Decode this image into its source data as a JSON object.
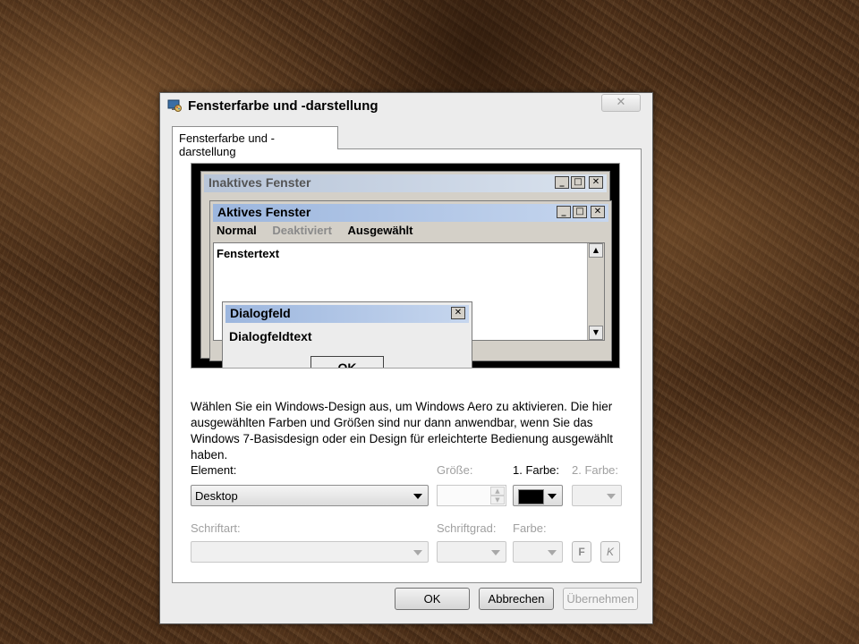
{
  "dialog": {
    "title": "Fensterfarbe und -darstellung",
    "close_glyph": "✕",
    "tab_label": "Fensterfarbe und -darstellung",
    "icon": "monitor-palette-icon"
  },
  "preview": {
    "inactive_title": "Inaktives Fenster",
    "active_title": "Aktives Fenster",
    "menu": [
      "Normal",
      "Deaktiviert",
      "Ausgewählt"
    ],
    "window_text": "Fenstertext",
    "dialog_title": "Dialogfeld",
    "dialog_text": "Dialogfeldtext",
    "ok_label": "OK"
  },
  "description": "Wählen Sie ein Windows-Design aus, um Windows Aero zu aktivieren. Die hier ausgewählten Farben und Größen sind nur dann anwendbar, wenn Sie das Windows 7-Basisdesign oder ein Design für erleichterte Bedienung ausgewählt haben.",
  "element": {
    "label": "Element:",
    "value": "Desktop"
  },
  "groesse": {
    "label": "Größe:",
    "value": ""
  },
  "farbe1": {
    "label": "1. Farbe:",
    "color": "#000000"
  },
  "farbe2": {
    "label": "2. Farbe:"
  },
  "schriftart": {
    "label": "Schriftart:",
    "value": ""
  },
  "schriftgrad": {
    "label": "Schriftgrad:",
    "value": ""
  },
  "schriftfarbe": {
    "label": "Farbe:"
  },
  "bold_label": "F",
  "italic_label": "K",
  "buttons": {
    "ok": "OK",
    "cancel": "Abbrechen",
    "apply": "Übernehmen"
  },
  "colors": {
    "active_title": "#9cb6de",
    "inactive_title": "#b8c5d8",
    "dialog_bg": "#ececec"
  }
}
